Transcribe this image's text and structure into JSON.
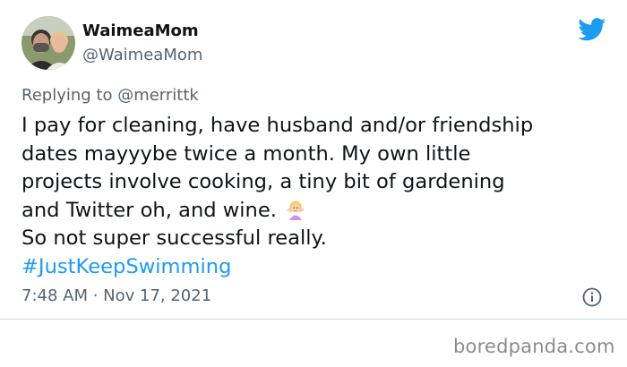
{
  "tweet": {
    "display_name": "WaimeaMom",
    "handle": "@WaimeaMom",
    "replying_prefix": "Replying to ",
    "replying_mention": "@merrittk",
    "body_part1": "I pay for cleaning, have husband and/or friendship\ndates mayyybe twice a month. My own little\nprojects involve cooking, a tiny bit of gardening\nand Twitter oh, and wine. ",
    "emoji_name": "person-shrugging-emoji",
    "body_part2": "\nSo not super successful really.\n",
    "hashtag": "#JustKeepSwimming",
    "timestamp": "7:48 AM · Nov 17, 2021"
  },
  "icons": {
    "brand": "twitter-bird-icon",
    "info": "info-icon"
  },
  "colors": {
    "accent": "#1d9bf0",
    "secondary_text": "#536471",
    "primary_text": "#0f1419"
  },
  "watermark": {
    "text": "boredpanda.com"
  }
}
